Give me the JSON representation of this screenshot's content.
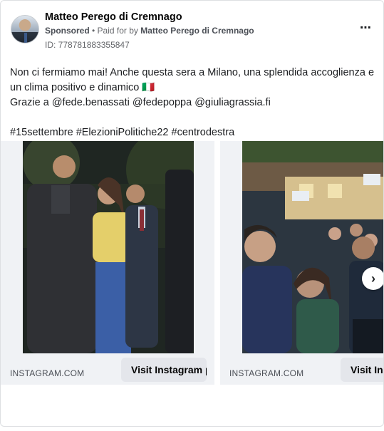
{
  "post": {
    "page_name": "Matteo Perego di Cremnago",
    "sponsored_label": "Sponsored",
    "paid_for_prefix": "• Paid for by",
    "paid_for_name": "Matteo Perego di Cremnago",
    "ad_id": "ID: 778781883355847",
    "more_icon": "more-horizontal-icon",
    "text_line1": "Non ci fermiamo mai! Anche questa sera a Milano, una splendida accoglienza e un clima positivo e dinamico 🇮🇹",
    "text_line2": "Grazie a @fede.benassati @fedepoppa @giuliagrassia.fi",
    "hashtags": "#15settembre #ElezioniPolitiche22 #centrodestra"
  },
  "carousel": {
    "cards": [
      {
        "source": "INSTAGRAM.COM",
        "button": "Visit Instagram profile"
      },
      {
        "source": "INSTAGRAM.COM",
        "button": "Visit Instagram profile"
      }
    ],
    "next_icon": "chevron-right-icon"
  },
  "colors": {
    "text": "#1c1e21",
    "secondary_text": "#65676b",
    "button_bg": "#e4e6eb",
    "card_bg": "#f0f2f5"
  }
}
